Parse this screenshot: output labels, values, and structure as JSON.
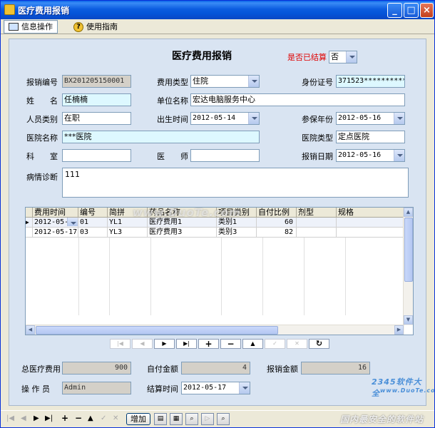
{
  "window": {
    "title": "医疗费用报销"
  },
  "tabs": [
    {
      "label": "信息操作",
      "icon": "info-icon",
      "active": true
    },
    {
      "label": "使用指南",
      "icon": "help-icon",
      "active": false
    }
  ],
  "form": {
    "title": "医疗费用报销",
    "settled_label": "是否已结算",
    "settled_value": "否",
    "labels": {
      "claim_no": "报销编号",
      "expense_type": "费用类型",
      "id_no": "身份证号",
      "name": "姓　　名",
      "employer": "单位名称",
      "person_type": "人员类别",
      "birth_date": "出生时间",
      "insured_year": "参保年份",
      "hospital_name": "医院名称",
      "hospital_type": "医院类型",
      "department": "科　　室",
      "doctor": "医　　师",
      "claim_date": "报销日期",
      "diagnosis": "病情诊断",
      "total_cost": "总医疗费用",
      "self_pay": "自付金额",
      "reimbursed": "报销金额",
      "operator": "操 作 员",
      "settle_time": "结算时间"
    },
    "values": {
      "claim_no": "BX201205150001",
      "expense_type": "住院",
      "id_no": "371523**********",
      "name": "任楠楠",
      "employer": "宏达电脑服务中心",
      "person_type": "在职",
      "birth_date": "2012-05-14",
      "insured_year": "2012-05-16",
      "hospital_name": "***医院",
      "hospital_type": "定点医院",
      "department": "",
      "doctor": "",
      "claim_date": "2012-05-16",
      "diagnosis": "111",
      "total_cost": "900",
      "self_pay": "4",
      "reimbursed": "16",
      "operator": "Admin",
      "settle_time": "2012-05-17"
    }
  },
  "grid": {
    "columns": [
      "费用时间",
      "编号",
      "简拼",
      "药品名称",
      "项目类别",
      "自付比例",
      "剂型",
      "规格"
    ],
    "rows": [
      [
        "2012-05-1",
        "01",
        "YL1",
        "医疗费用1",
        "类别1",
        "60",
        "",
        ""
      ],
      [
        "2012-05-17",
        "03",
        "YL3",
        "医疗费用3",
        "类别3",
        "82",
        "",
        ""
      ]
    ]
  },
  "grid_nav": [
    {
      "icon": "first-icon",
      "glyph": "|◀",
      "enabled": false
    },
    {
      "icon": "prev-icon",
      "glyph": "◀",
      "enabled": false
    },
    {
      "icon": "next-icon",
      "glyph": "▶",
      "enabled": true
    },
    {
      "icon": "last-icon",
      "glyph": "▶|",
      "enabled": true
    },
    {
      "icon": "insert-icon",
      "glyph": "+",
      "enabled": true
    },
    {
      "icon": "delete-icon",
      "glyph": "−",
      "enabled": true
    },
    {
      "icon": "edit-icon",
      "glyph": "▲",
      "enabled": true
    },
    {
      "icon": "post-icon",
      "glyph": "✓",
      "enabled": false
    },
    {
      "icon": "cancel-icon",
      "glyph": "✕",
      "enabled": false
    },
    {
      "icon": "refresh-icon",
      "glyph": "↻",
      "enabled": true
    }
  ],
  "bottom": {
    "add_label": "增加"
  },
  "watermarks": {
    "center": "www.DuoTe.com",
    "brand": "2345软件大全",
    "brand_url": "www.DuoTe.com",
    "slogan": "国内最安全的软件站"
  }
}
